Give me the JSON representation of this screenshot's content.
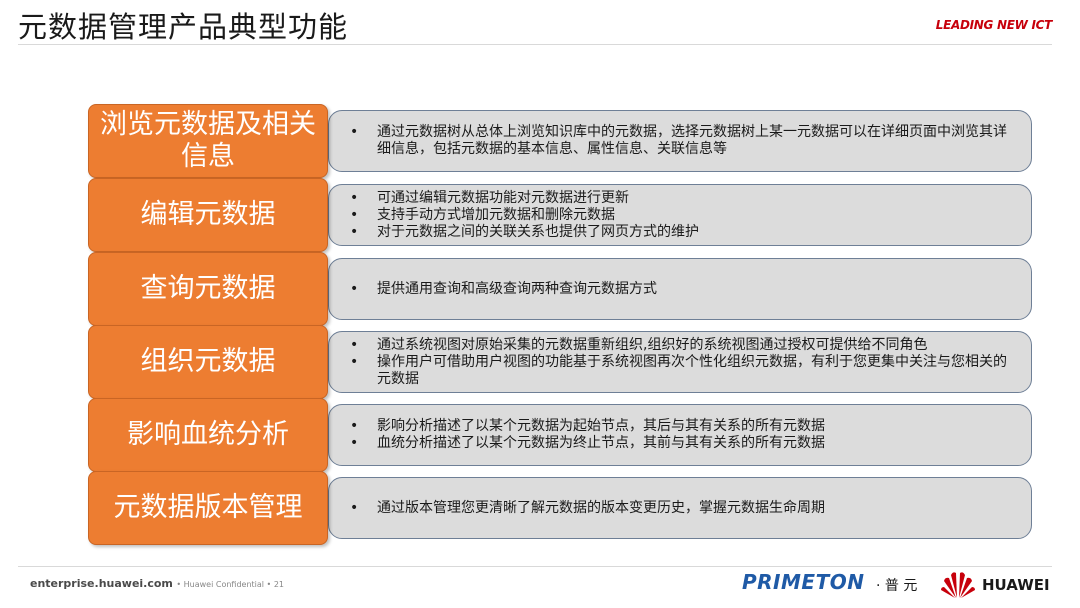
{
  "header": {
    "title": "元数据管理产品典型功能",
    "tagline_strong": "LEADING",
    "tagline_rest": " NEW ICT"
  },
  "rows": [
    {
      "label": "浏览元数据及相关信息",
      "items": [
        "通过元数据树从总体上浏览知识库中的元数据，选择元数据树上某一元数据可以在详细页面中浏览其详细信息，包括元数据的基本信息、属性信息、关联信息等"
      ]
    },
    {
      "label": "编辑元数据",
      "items": [
        "可通过编辑元数据功能对元数据进行更新",
        "支持手动方式增加元数据和删除元数据",
        "对于元数据之间的关联关系也提供了网页方式的维护"
      ]
    },
    {
      "label": "查询元数据",
      "items": [
        "提供通用查询和高级查询两种查询元数据方式"
      ]
    },
    {
      "label": "组织元数据",
      "items": [
        "通过系统视图对原始采集的元数据重新组织,组织好的系统视图通过授权可提供给不同角色",
        "操作用户可借助用户视图的功能基于系统视图再次个性化组织元数据，有利于您更集中关注与您相关的元数据"
      ]
    },
    {
      "label": "影响血统分析",
      "items": [
        "影响分析描述了以某个元数据为起始节点，其后与其有关系的所有元数据",
        "血统分析描述了以某个元数据为终止节点，其前与其有关系的所有元数据"
      ]
    },
    {
      "label": "元数据版本管理",
      "items": [
        "通过版本管理您更清晰了解元数据的版本变更历史，掌握元数据生命周期"
      ]
    }
  ],
  "footer": {
    "site": "enterprise.huawei.com",
    "confidential": "•  Huawei Confidential  •  21",
    "primeton": "PRIMETON",
    "primeton_cn": "· 普 元",
    "huawei": "HUAWEI"
  },
  "colors": {
    "accent_orange": "#ed7d31",
    "desc_gray": "#dcdcdc",
    "huawei_red": "#c7000b",
    "primeton_blue": "#1f5aa6"
  }
}
